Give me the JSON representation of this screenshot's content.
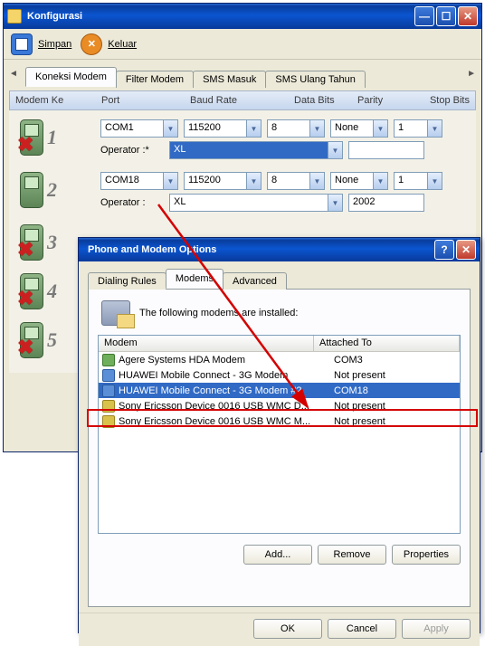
{
  "main_window": {
    "title": "Konfigurasi",
    "toolbar": {
      "save": "Simpan",
      "exit": "Keluar"
    },
    "tabs": {
      "t1": "Koneksi Modem",
      "t2": "Filter Modem",
      "t3": "SMS Masuk",
      "t4": "SMS Ulang Tahun"
    },
    "columns": {
      "modem": "Modem Ke",
      "port": "Port",
      "baud": "Baud Rate",
      "data": "Data Bits",
      "parity": "Parity",
      "stop": "Stop Bits"
    },
    "op_label": "Operator  :",
    "op_label_req": "Operator  :*",
    "rows": [
      {
        "num": "1",
        "disabled": true,
        "port": "COM1",
        "baud": "115200",
        "data": "8",
        "parity": "None",
        "stop": "1",
        "operator": "XL",
        "op_sel": true
      },
      {
        "num": "2",
        "disabled": false,
        "port": "COM18",
        "baud": "115200",
        "data": "8",
        "parity": "None",
        "stop": "1",
        "operator": "XL",
        "extra": "2002"
      },
      {
        "num": "3",
        "disabled": true
      },
      {
        "num": "4",
        "disabled": true
      },
      {
        "num": "5",
        "disabled": true
      }
    ]
  },
  "dialog": {
    "title": "Phone and Modem Options",
    "tabs": {
      "t1": "Dialing Rules",
      "t2": "Modems",
      "t3": "Advanced"
    },
    "intro": "The following modems are installed:",
    "columns": {
      "c1": "Modem",
      "c2": "Attached To"
    },
    "items": [
      {
        "ico": "g",
        "name": "Agere Systems HDA Modem",
        "att": "COM3"
      },
      {
        "ico": "b",
        "name": "HUAWEI Mobile Connect - 3G Modem",
        "att": "Not present"
      },
      {
        "ico": "b",
        "name": "HUAWEI Mobile Connect - 3G Modem #2",
        "att": "COM18",
        "sel": true
      },
      {
        "ico": "y",
        "name": "Sony Ericsson Device 0016 USB WMC D...",
        "att": "Not present"
      },
      {
        "ico": "y",
        "name": "Sony Ericsson Device 0016 USB WMC M...",
        "att": "Not present"
      }
    ],
    "buttons": {
      "add": "Add...",
      "remove": "Remove",
      "props": "Properties",
      "ok": "OK",
      "cancel": "Cancel",
      "apply": "Apply"
    }
  }
}
